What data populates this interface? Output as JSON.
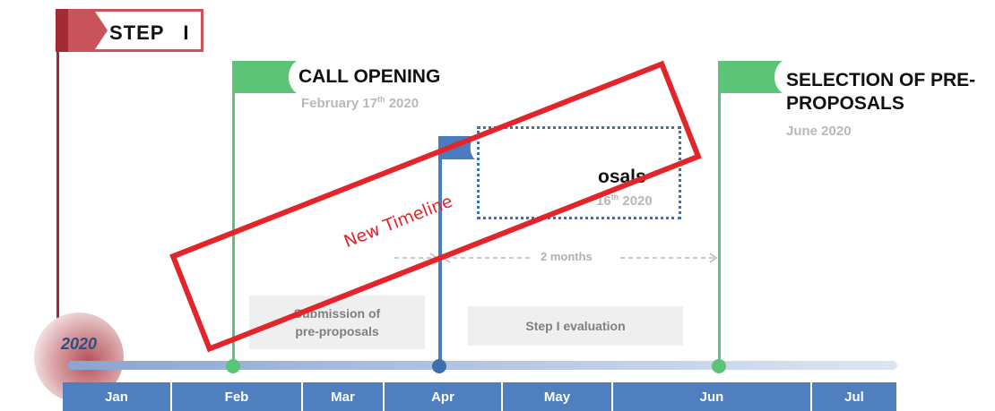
{
  "step": {
    "label": "STEP   I"
  },
  "year": "2020",
  "milestones": [
    {
      "title": "CALL OPENING",
      "date_main": "February 17",
      "date_sup": "th",
      "date_tail": " 2020"
    },
    {
      "title": "osals",
      "date_main": "16",
      "date_sup": "th",
      "date_tail": " 2020"
    },
    {
      "title_line1": "SELECTION OF PRE-",
      "title_line2": "PROPOSALS",
      "date": "June 2020"
    }
  ],
  "durations": [
    {
      "label": "2 months"
    }
  ],
  "phases": [
    {
      "line1": "Submission of",
      "line2": "pre-proposals"
    },
    {
      "label": "Step I evaluation"
    }
  ],
  "months": [
    "Jan",
    "Feb",
    "Mar",
    "Apr",
    "May",
    "Jun",
    "Jul"
  ],
  "stamp": {
    "label": "New Timeline"
  },
  "colors": {
    "step_flag": "#c9535a",
    "milestone_flag": "#5cc476",
    "submission_flag": "#4a7cc0",
    "month_bar": "#4f7fbf",
    "stamp": "#e2242b"
  }
}
